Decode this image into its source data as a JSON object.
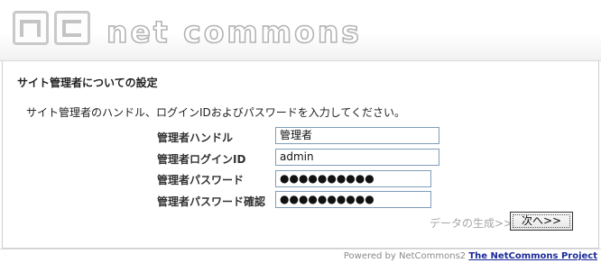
{
  "header": {
    "logo_text": "net commons"
  },
  "section": {
    "title": "サイト管理者についての設定",
    "description": "サイト管理者のハンドル、ログインIDおよびパスワードを入力してください。"
  },
  "form": {
    "handle": {
      "label": "管理者ハンドル",
      "value": "管理者"
    },
    "login_id": {
      "label": "管理者ログインID",
      "value": "admin"
    },
    "password": {
      "label": "管理者パスワード",
      "value": "●●●●●●●●●●"
    },
    "password_confirm": {
      "label": "管理者パスワード確認",
      "value": "●●●●●●●●●●"
    }
  },
  "actions": {
    "prev_label": "データの生成>>",
    "next_label": "次へ>>"
  },
  "footer": {
    "powered_by": "Powered by NetCommons2",
    "project_link": "The NetCommons Project"
  }
}
